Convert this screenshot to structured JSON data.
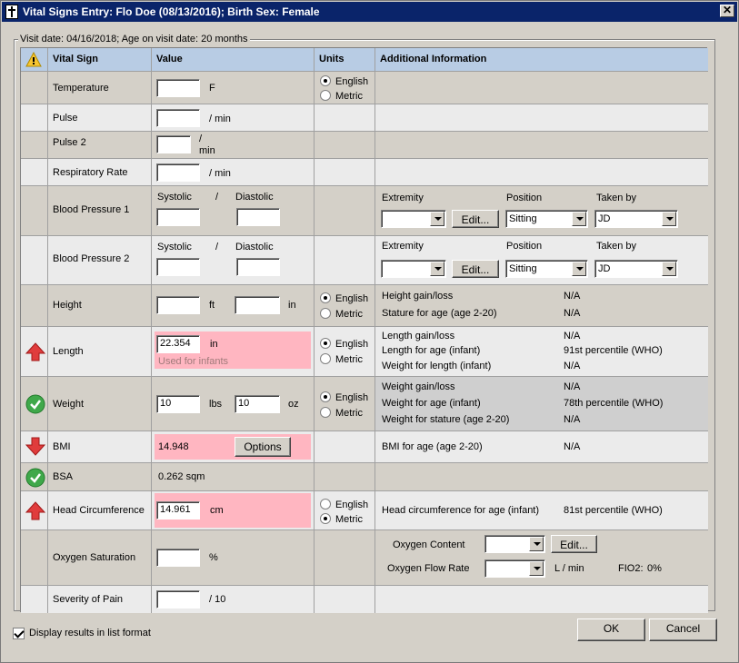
{
  "window": {
    "title": "Vital Signs Entry: Flo Doe (08/13/2016); Birth Sex: Female",
    "close_glyph": "✕"
  },
  "visit": {
    "label": "Visit date: 04/16/2018; Age on visit date: 20 months"
  },
  "columns": {
    "vital_sign": "Vital Sign",
    "value": "Value",
    "units": "Units",
    "additional": "Additional Information"
  },
  "units": {
    "english": "English",
    "metric": "Metric"
  },
  "temperature": {
    "label": "Temperature",
    "unit": "F",
    "value": "",
    "units_selected": "English"
  },
  "pulse": {
    "label": "Pulse",
    "unit": "/ min",
    "value": ""
  },
  "pulse2": {
    "label": "Pulse 2",
    "unit_top": "/",
    "unit_bottom": "min",
    "value": ""
  },
  "respiratory": {
    "label": "Respiratory Rate",
    "unit": "/ min",
    "value": ""
  },
  "bp1": {
    "label": "Blood Pressure 1",
    "systolic": "Systolic",
    "slash": "/",
    "diastolic": "Diastolic",
    "extremity": "Extremity",
    "position": "Position",
    "taken_by": "Taken by",
    "extremity_value": "",
    "edit": "Edit...",
    "position_value": "Sitting",
    "taken_by_value": "JD"
  },
  "bp2": {
    "label": "Blood Pressure 2",
    "systolic": "Systolic",
    "slash": "/",
    "diastolic": "Diastolic",
    "extremity": "Extremity",
    "position": "Position",
    "taken_by": "Taken by",
    "extremity_value": "",
    "edit": "Edit...",
    "position_value": "Sitting",
    "taken_by_value": "JD"
  },
  "height": {
    "label": "Height",
    "unit_ft": "ft",
    "unit_in": "in",
    "units_selected": "English",
    "info": [
      {
        "label": "Height gain/loss",
        "value": "N/A"
      },
      {
        "label": "Stature for age (age 2-20)",
        "value": "N/A"
      }
    ]
  },
  "length": {
    "label": "Length",
    "value": "22.354",
    "unit": "in",
    "note": "Used for infants",
    "units_selected": "English",
    "status": "high",
    "info": [
      {
        "label": "Length gain/loss",
        "value": "N/A"
      },
      {
        "label": "Length for age (infant)",
        "value": "91st percentile (WHO)"
      },
      {
        "label": "Weight for length (infant)",
        "value": "N/A"
      }
    ]
  },
  "weight": {
    "label": "Weight",
    "lbs_value": "10",
    "lbs_unit": "lbs",
    "oz_value": "10",
    "oz_unit": "oz",
    "units_selected": "English",
    "status": "ok",
    "info": [
      {
        "label": "Weight gain/loss",
        "value": "N/A"
      },
      {
        "label": "Weight for age (infant)",
        "value": "78th percentile (WHO)"
      },
      {
        "label": "Weight for stature (age 2-20)",
        "value": "N/A"
      }
    ]
  },
  "bmi": {
    "label": "BMI",
    "value": "14.948",
    "options": "Options",
    "status": "low",
    "info": [
      {
        "label": "BMI for age (age 2-20)",
        "value": "N/A"
      }
    ]
  },
  "bsa": {
    "label": "BSA",
    "value": "0.262 sqm",
    "status": "ok"
  },
  "head": {
    "label": "Head Circumference",
    "value": "14.961",
    "unit": "cm",
    "units_selected": "Metric",
    "status": "high",
    "info": [
      {
        "label": "Head circumference for age (infant)",
        "value": "81st percentile (WHO)"
      }
    ]
  },
  "oxygen": {
    "label": "Oxygen Saturation",
    "unit": "%",
    "content_label": "Oxygen Content",
    "content_value": "",
    "edit": "Edit...",
    "flow_label": "Oxygen Flow Rate",
    "flow_value": "",
    "flow_unit": "L / min",
    "fio2_label": "FIO2:",
    "fio2_value": "0%"
  },
  "pain": {
    "label": "Severity of Pain",
    "unit": "/ 10",
    "value": ""
  },
  "footer": {
    "list_format": "Display results in list format",
    "list_format_checked": true,
    "ok": "OK",
    "cancel": "Cancel"
  },
  "colors": {
    "title_bar": "#0a246a",
    "header_row": "#b8cce4",
    "out_of_range": "#ffb6c1",
    "arrow_red": "#e03c3c",
    "check_green": "#3fa84a"
  },
  "icons": {
    "warning": "warning-icon",
    "up_arrow": "up-arrow-icon",
    "down_arrow": "down-arrow-icon",
    "check": "check-icon"
  }
}
